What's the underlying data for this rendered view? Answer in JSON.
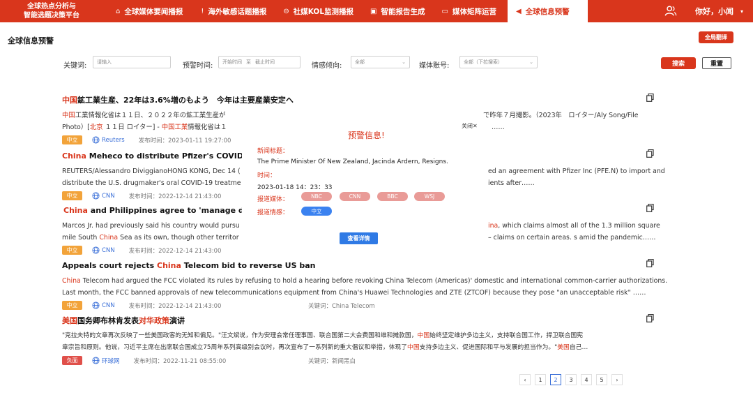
{
  "brand": {
    "line1": "全球热点分析与",
    "line2": "智能选题决策平台"
  },
  "nav": [
    {
      "icon": "⌂",
      "label": "全球媒体要闻播报"
    },
    {
      "icon": "!",
      "label": "海外敏感话题播报"
    },
    {
      "icon": "⊖",
      "label": "社媒KOL监测播报"
    },
    {
      "icon": "▣",
      "label": "智能报告生成"
    },
    {
      "icon": "▭",
      "label": "媒体矩阵运营"
    },
    {
      "icon": "◀",
      "label": "全球信息预警"
    }
  ],
  "user": {
    "greeting": "你好，小闻",
    "caret": "▾"
  },
  "page": {
    "title": "全球信息预警",
    "translate_label": "全局翻译"
  },
  "filters": {
    "keyword_label": "关键词:",
    "keyword_placeholder": "请输入",
    "time_label": "预警时间:",
    "time_start": "开始时间",
    "time_sep": "至",
    "time_end": "截止时间",
    "sentiment_label": "情感倾向:",
    "sentiment_value": "全部",
    "account_label": "媒体账号:",
    "account_value": "全部（下拉搜索）",
    "search_label": "搜索",
    "reset_label": "重置"
  },
  "articles": [
    {
      "title_hl": "中国",
      "title": "鉱工業生産、22年は3.6%増のもよう　今年は主要産業安定へ",
      "line1_hl": "中国",
      "line1": "工業情報化省は１１日、２０２２年の鉱工業生産が",
      "line1_tail": "で昨年７月撮影。（2023年　ロイター/Aly Song/File",
      "line2a": "Photo）[",
      "line2_hl1": "北京",
      "line2b": " １１日 ロイター] - ",
      "line2_hl2": "中国工業",
      "line2c": "情報化省は１",
      "line2_tail": "……",
      "tag": "中立",
      "source": "Reuters",
      "time": "发布时间：2023-01-11 19:27:00",
      "keyword": ""
    },
    {
      "title_hl": "China",
      "title": " Meheco to distribute Pfizer's COVID treat",
      "line1": "REUTERS/Alessandro DiviggianoHONG KONG, Dec 14 (",
      "line1_tail": "ed an agreement with Pfizer Inc (PFE.N) to import and",
      "line2": "distribute the U.S. drugmaker's oral COVID-19 treatme",
      "line2_tail": "ients after……",
      "tag": "中立",
      "source": "CNN",
      "time": "发布时间：2022-12-14 21:43:00",
      "keyword": ""
    },
    {
      "title_hl": "China",
      "title": " and Philippines agree to  'manage differ",
      "line1": "Marcos Jr. had previously said his country would pursu",
      "line1_tail_hl": "ina",
      "line1_tail": ", which claims almost all of the 1.3 million square",
      "line2a": "mile South ",
      "line2_hl": "China",
      "line2b": " Sea as its own, though other territor",
      "line2_tail": "– claims on certain areas. s amid the pandemic……",
      "tag": "中立",
      "source": "CNN",
      "time": "发布时间：2022-12-14 21:43:00",
      "keyword": ""
    },
    {
      "title_a": "Appeals court rejects ",
      "title_hl": "China",
      "title_b": " Telecom bid to reverse US ban",
      "line1_hl": "China",
      "line1": " Telecom had argued the FCC violated its rules by refusing to hold a hearing before revoking China Telecom (Americas)'  domestic and international common-carrier authorizations.",
      "line2": "Last month, the FCC banned approvals of new telecommunications equipment from China's Huawei Technologies and ZTE (ZTCOF) because they pose \"an unacceptable risk\"  ……",
      "tag": "中立",
      "source": "CNN",
      "time": "发布时间：2022-12-14 21:43:00",
      "keyword": "关键词：China Telecom"
    },
    {
      "title_hl": "美国",
      "title_a": "国务卿布林肯发表",
      "title_hl2": "对华政策",
      "title_b": "演讲",
      "line1a": "\"克拉夫特的文章再次反映了一些美国政客的无知和偏见。\"汪文斌说，作为安理会常任理事国、联合国第二大会费国和维和摊款国，",
      "line1_hl": "中国",
      "line1b": "始终坚定维护多边主义，支持联合国工作，捍卫联合国宪",
      "line2a": "章宗旨和原则。他说，习近平主席在出席联合国成立75周年系列高级别会议时，再次宣布了一系列新的重大倡议和举措，体现了",
      "line2_hl": "中国",
      "line2b": "支持多边主义、促进国际和平与发展的担当作为。\"",
      "line2_hl2": "美国",
      "line2c": "自己…",
      "tag": "负面",
      "source": "环球网",
      "time": "发布时间：2022-11-21 08:55:00",
      "keyword": "关键词：新闻黑白"
    }
  ],
  "popup": {
    "title": "预警信息!",
    "close_label": "关闭✕",
    "news_title_label": "新闻标题：",
    "news_title": "The Prime Minister Of New Zealand, Jacinda Ardern, Resigns.",
    "time_label": "时间：",
    "time_value": "2023-01-18 14：23：33",
    "media_label": "报道媒体：",
    "media": [
      "NBC",
      "CNN",
      "BBC",
      "WSJ"
    ],
    "sentiment_label": "报道情感：",
    "sentiment_value": "中立",
    "detail_label": "查看详情"
  },
  "pagination": {
    "prev": "‹",
    "pages": [
      "1",
      "2",
      "3",
      "4",
      "5"
    ],
    "current": "2",
    "next": "›"
  },
  "colors": {
    "brand_red": "#d9361c",
    "link_blue": "#3a6fd8",
    "neutral_tag": "#f2a33a",
    "negative_tag": "#e0504a"
  }
}
